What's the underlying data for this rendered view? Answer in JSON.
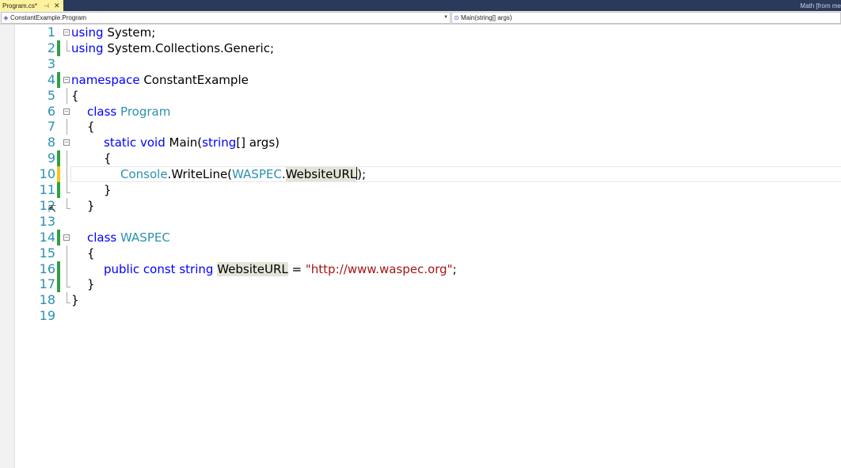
{
  "tab": {
    "title": "Program.cs*",
    "pin": "⊣",
    "close": "✕"
  },
  "right_tab": {
    "label": "Math [from me"
  },
  "navbar": {
    "left_icon": "class-icon",
    "left_text": "ConstantExample.Program",
    "right_icon": "method-icon",
    "right_text": "Main(string[] args)"
  },
  "colors": {
    "tabstrip": "#2b3a5a",
    "active_tab": "#fff29d",
    "saved_change": "#2ea043",
    "unsaved_change": "#f5c518",
    "keyword": "#0000ff",
    "type": "#2b91af",
    "string": "#a31515"
  },
  "editor": {
    "lines": [
      {
        "n": "1",
        "bar": "",
        "tokens": [
          [
            "kw",
            "using"
          ],
          [
            "",
            "System;"
          ]
        ]
      },
      {
        "n": "2",
        "bar": "green",
        "tokens": [
          [
            "kw",
            "using"
          ],
          [
            "",
            "System.Collections.Generic;"
          ]
        ]
      },
      {
        "n": "3",
        "bar": "",
        "tokens": []
      },
      {
        "n": "4",
        "bar": "green",
        "tokens": [
          [
            "kw",
            "namespace"
          ],
          [
            "",
            "ConstantExample"
          ]
        ]
      },
      {
        "n": "5",
        "bar": "",
        "tokens": [
          [
            "",
            "{"
          ]
        ]
      },
      {
        "n": "6",
        "bar": "",
        "tokens": [
          [
            "kw",
            "class"
          ],
          [
            "type",
            "Program"
          ]
        ]
      },
      {
        "n": "7",
        "bar": "",
        "tokens": [
          [
            "",
            "{"
          ]
        ]
      },
      {
        "n": "8",
        "bar": "",
        "tokens": [
          [
            "kw",
            "static"
          ],
          [
            "kw",
            "void"
          ],
          [
            "",
            "Main("
          ],
          [
            "kw",
            "string"
          ],
          [
            "",
            "[] args)"
          ]
        ]
      },
      {
        "n": "9",
        "bar": "green",
        "tokens": [
          [
            "",
            "{"
          ]
        ]
      },
      {
        "n": "10",
        "bar": "yellow",
        "tokens": [
          [
            "type",
            "Console"
          ],
          [
            "",
            ".WriteLine("
          ],
          [
            "type",
            "WASPEC"
          ],
          [
            "",
            "."
          ],
          [
            "hl",
            "WebsiteURL"
          ],
          [
            "",
            ");"
          ]
        ]
      },
      {
        "n": "11",
        "bar": "green",
        "tokens": [
          [
            "",
            "}"
          ]
        ]
      },
      {
        "n": "12",
        "bar": "",
        "tokens": [
          [
            "",
            "}"
          ]
        ]
      },
      {
        "n": "13",
        "bar": "",
        "tokens": []
      },
      {
        "n": "14",
        "bar": "green",
        "tokens": [
          [
            "kw",
            "class"
          ],
          [
            "type",
            "WASPEC"
          ]
        ]
      },
      {
        "n": "15",
        "bar": "",
        "tokens": [
          [
            "",
            "{"
          ]
        ]
      },
      {
        "n": "16",
        "bar": "green",
        "tokens": [
          [
            "kw",
            "public"
          ],
          [
            "kw",
            "const"
          ],
          [
            "kw",
            "string"
          ],
          [
            "hl",
            "WebsiteURL"
          ],
          [
            "",
            "="
          ],
          [
            "str",
            "\"http://www.waspec.org\""
          ],
          [
            "",
            ";"
          ]
        ]
      },
      {
        "n": "17",
        "bar": "green",
        "tokens": [
          [
            "",
            "}"
          ]
        ]
      },
      {
        "n": "18",
        "bar": "",
        "tokens": [
          [
            "",
            "}"
          ]
        ]
      },
      {
        "n": "19",
        "bar": "",
        "tokens": []
      }
    ]
  }
}
